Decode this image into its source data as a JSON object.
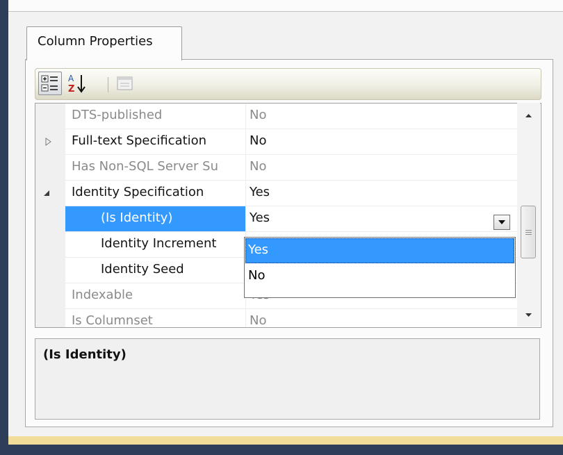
{
  "tab": {
    "label": "Column Properties"
  },
  "toolbar": {
    "categorized_icon": "categorized-view-icon",
    "alphabetical_icon": "sort-alphabetical-icon",
    "property_pages_icon": "property-pages-icon",
    "sort_glyph_a": "A",
    "sort_glyph_z": "Z"
  },
  "grid": {
    "rows": [
      {
        "name": "DTS-published",
        "value": "No"
      },
      {
        "name": "Full-text Specification",
        "value": "No"
      },
      {
        "name": "Has Non-SQL Server Su",
        "value": "No"
      },
      {
        "name": "Identity Specification",
        "value": "Yes"
      },
      {
        "name": "(Is Identity)",
        "value": "Yes"
      },
      {
        "name": "Identity Increment",
        "value": ""
      },
      {
        "name": "Identity Seed",
        "value": ""
      },
      {
        "name": "Indexable",
        "value": "Yes"
      },
      {
        "name": "Is Columnset",
        "value": "No"
      }
    ]
  },
  "dropdown": {
    "options": [
      {
        "label": "Yes",
        "selected": true
      },
      {
        "label": "No",
        "selected": false
      }
    ]
  },
  "description": {
    "title": "(Is Identity)"
  },
  "colors": {
    "selection": "#3399ff",
    "readonly_text": "#8a8a8a"
  }
}
